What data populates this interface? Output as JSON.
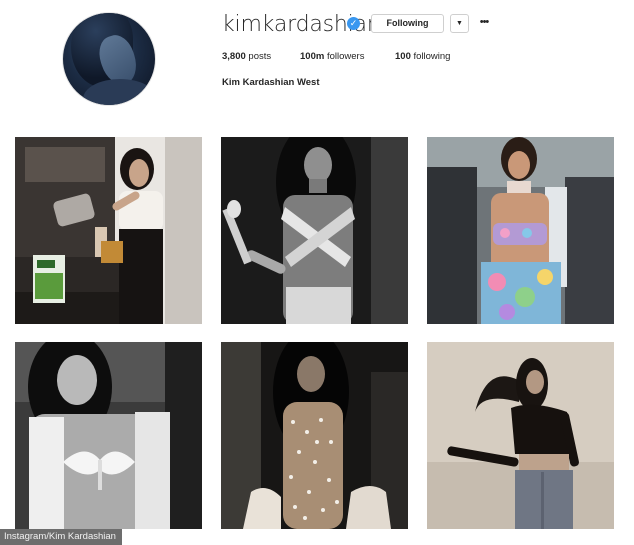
{
  "profile": {
    "username": "kimkardashian",
    "verified_icon": "verified-badge-icon",
    "following_label": "Following",
    "dropdown_icon": "caret-down-icon",
    "more_icon": "ellipsis-icon",
    "more_symbol": "•••",
    "dropdown_symbol": "▼",
    "verified_symbol": "✓",
    "posts_count": "3,800",
    "posts_label": "posts",
    "followers_count": "100m",
    "followers_label": "followers",
    "following_count": "100",
    "following_stat_label": "following",
    "full_name": "Kim Kardashian West",
    "accent_color": "#3897f0"
  },
  "posts": [
    {
      "id": "post-1",
      "description_icon": "photo-kitchen"
    },
    {
      "id": "post-2",
      "description_icon": "photo-bw-microphone"
    },
    {
      "id": "post-3",
      "description_icon": "photo-colorful-outfit"
    },
    {
      "id": "post-4",
      "description_icon": "photo-bw-butterfly-top"
    },
    {
      "id": "post-5",
      "description_icon": "photo-sparkle-sheer-dress"
    },
    {
      "id": "post-6",
      "description_icon": "photo-sepia-jeans"
    }
  ],
  "credit": {
    "text": "Instagram/Kim Kardashian"
  }
}
